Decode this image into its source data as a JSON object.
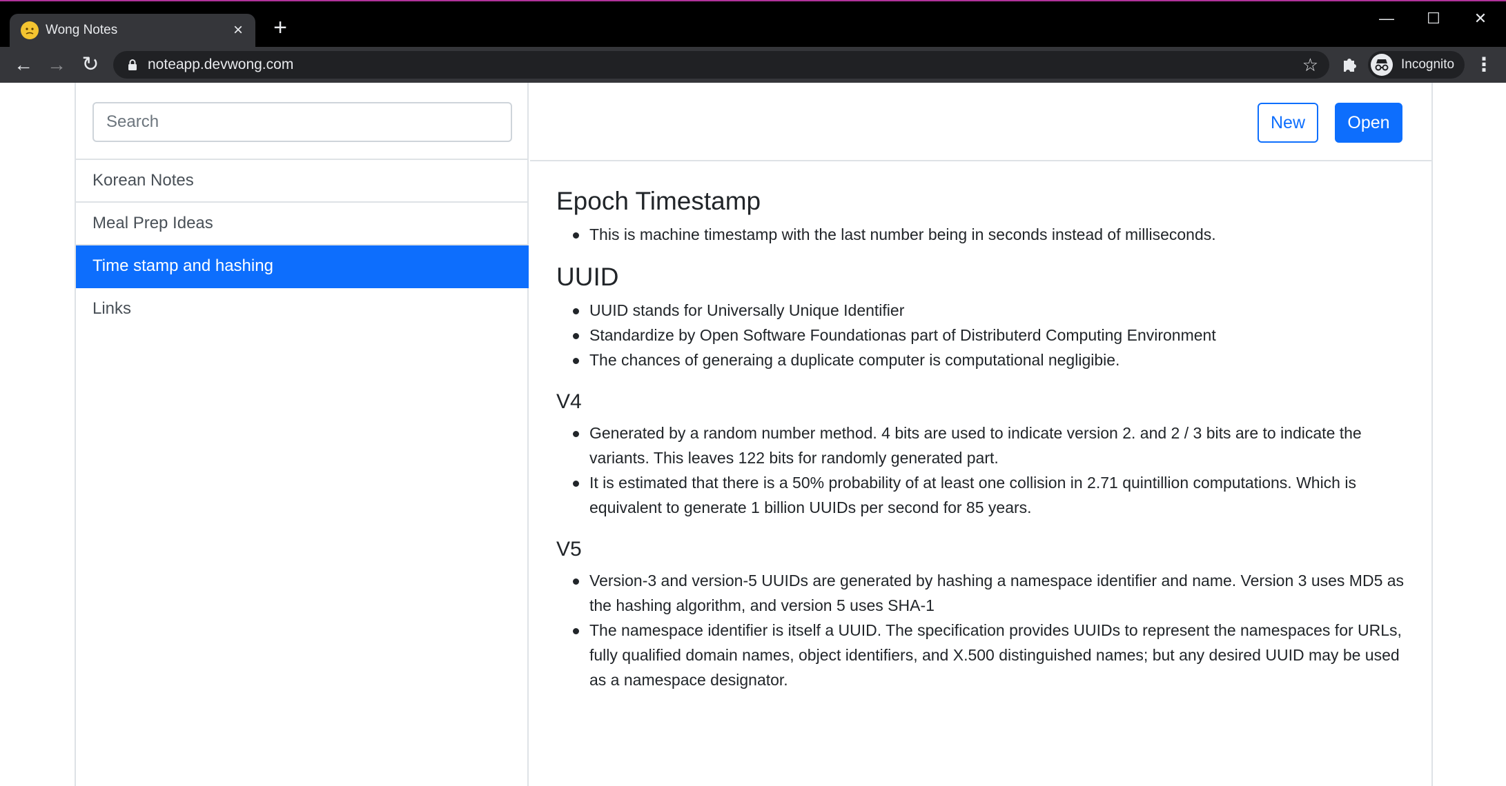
{
  "browser": {
    "tab_title": "Wong Notes",
    "url": "noteapp.devwong.com",
    "profile_label": "Incognito"
  },
  "sidebar": {
    "search_placeholder": "Search",
    "notes": [
      {
        "title": "Korean Notes",
        "active": false
      },
      {
        "title": "Meal Prep Ideas",
        "active": false
      },
      {
        "title": "Time stamp and hashing",
        "active": true
      },
      {
        "title": "Links",
        "active": false
      }
    ]
  },
  "toolbar": {
    "new_label": "New",
    "open_label": "Open"
  },
  "note": {
    "sections": [
      {
        "heading": "Epoch Timestamp",
        "bullets": [
          "This is machine timestamp with the last number being in seconds instead of milliseconds."
        ]
      },
      {
        "heading": "UUID",
        "bullets": [
          "UUID stands for Universally Unique Identifier",
          "Standardize by Open Software Foundationas part of Distributerd Computing Environment",
          "The chances of generaing a duplicate computer is computational negligibie."
        ]
      },
      {
        "heading": "V4",
        "bullets": [
          "Generated by a random number method. 4 bits are used to indicate version 2. and 2 / 3 bits are to indicate the variants. This leaves 122 bits for randomly generated part.",
          "It is estimated that there is a 50% probability of at least one collision in 2.71 quintillion computations. Which is equivalent to generate 1 billion UUIDs per second for 85 years."
        ]
      },
      {
        "heading": "V5",
        "bullets": [
          "Version-3 and version-5 UUIDs are generated by hashing a namespace identifier and name. Version 3 uses MD5 as the hashing algorithm, and version 5 uses SHA-1",
          "The namespace identifier is itself a UUID. The specification provides UUIDs to represent the namespaces for URLs, fully qualified domain names, object identifiers, and X.500 distinguished names; but any desired UUID may be used as a namespace designator."
        ]
      }
    ]
  },
  "colors": {
    "accent": "#0d6efd",
    "border": "#dee2e6",
    "text": "#212529"
  }
}
